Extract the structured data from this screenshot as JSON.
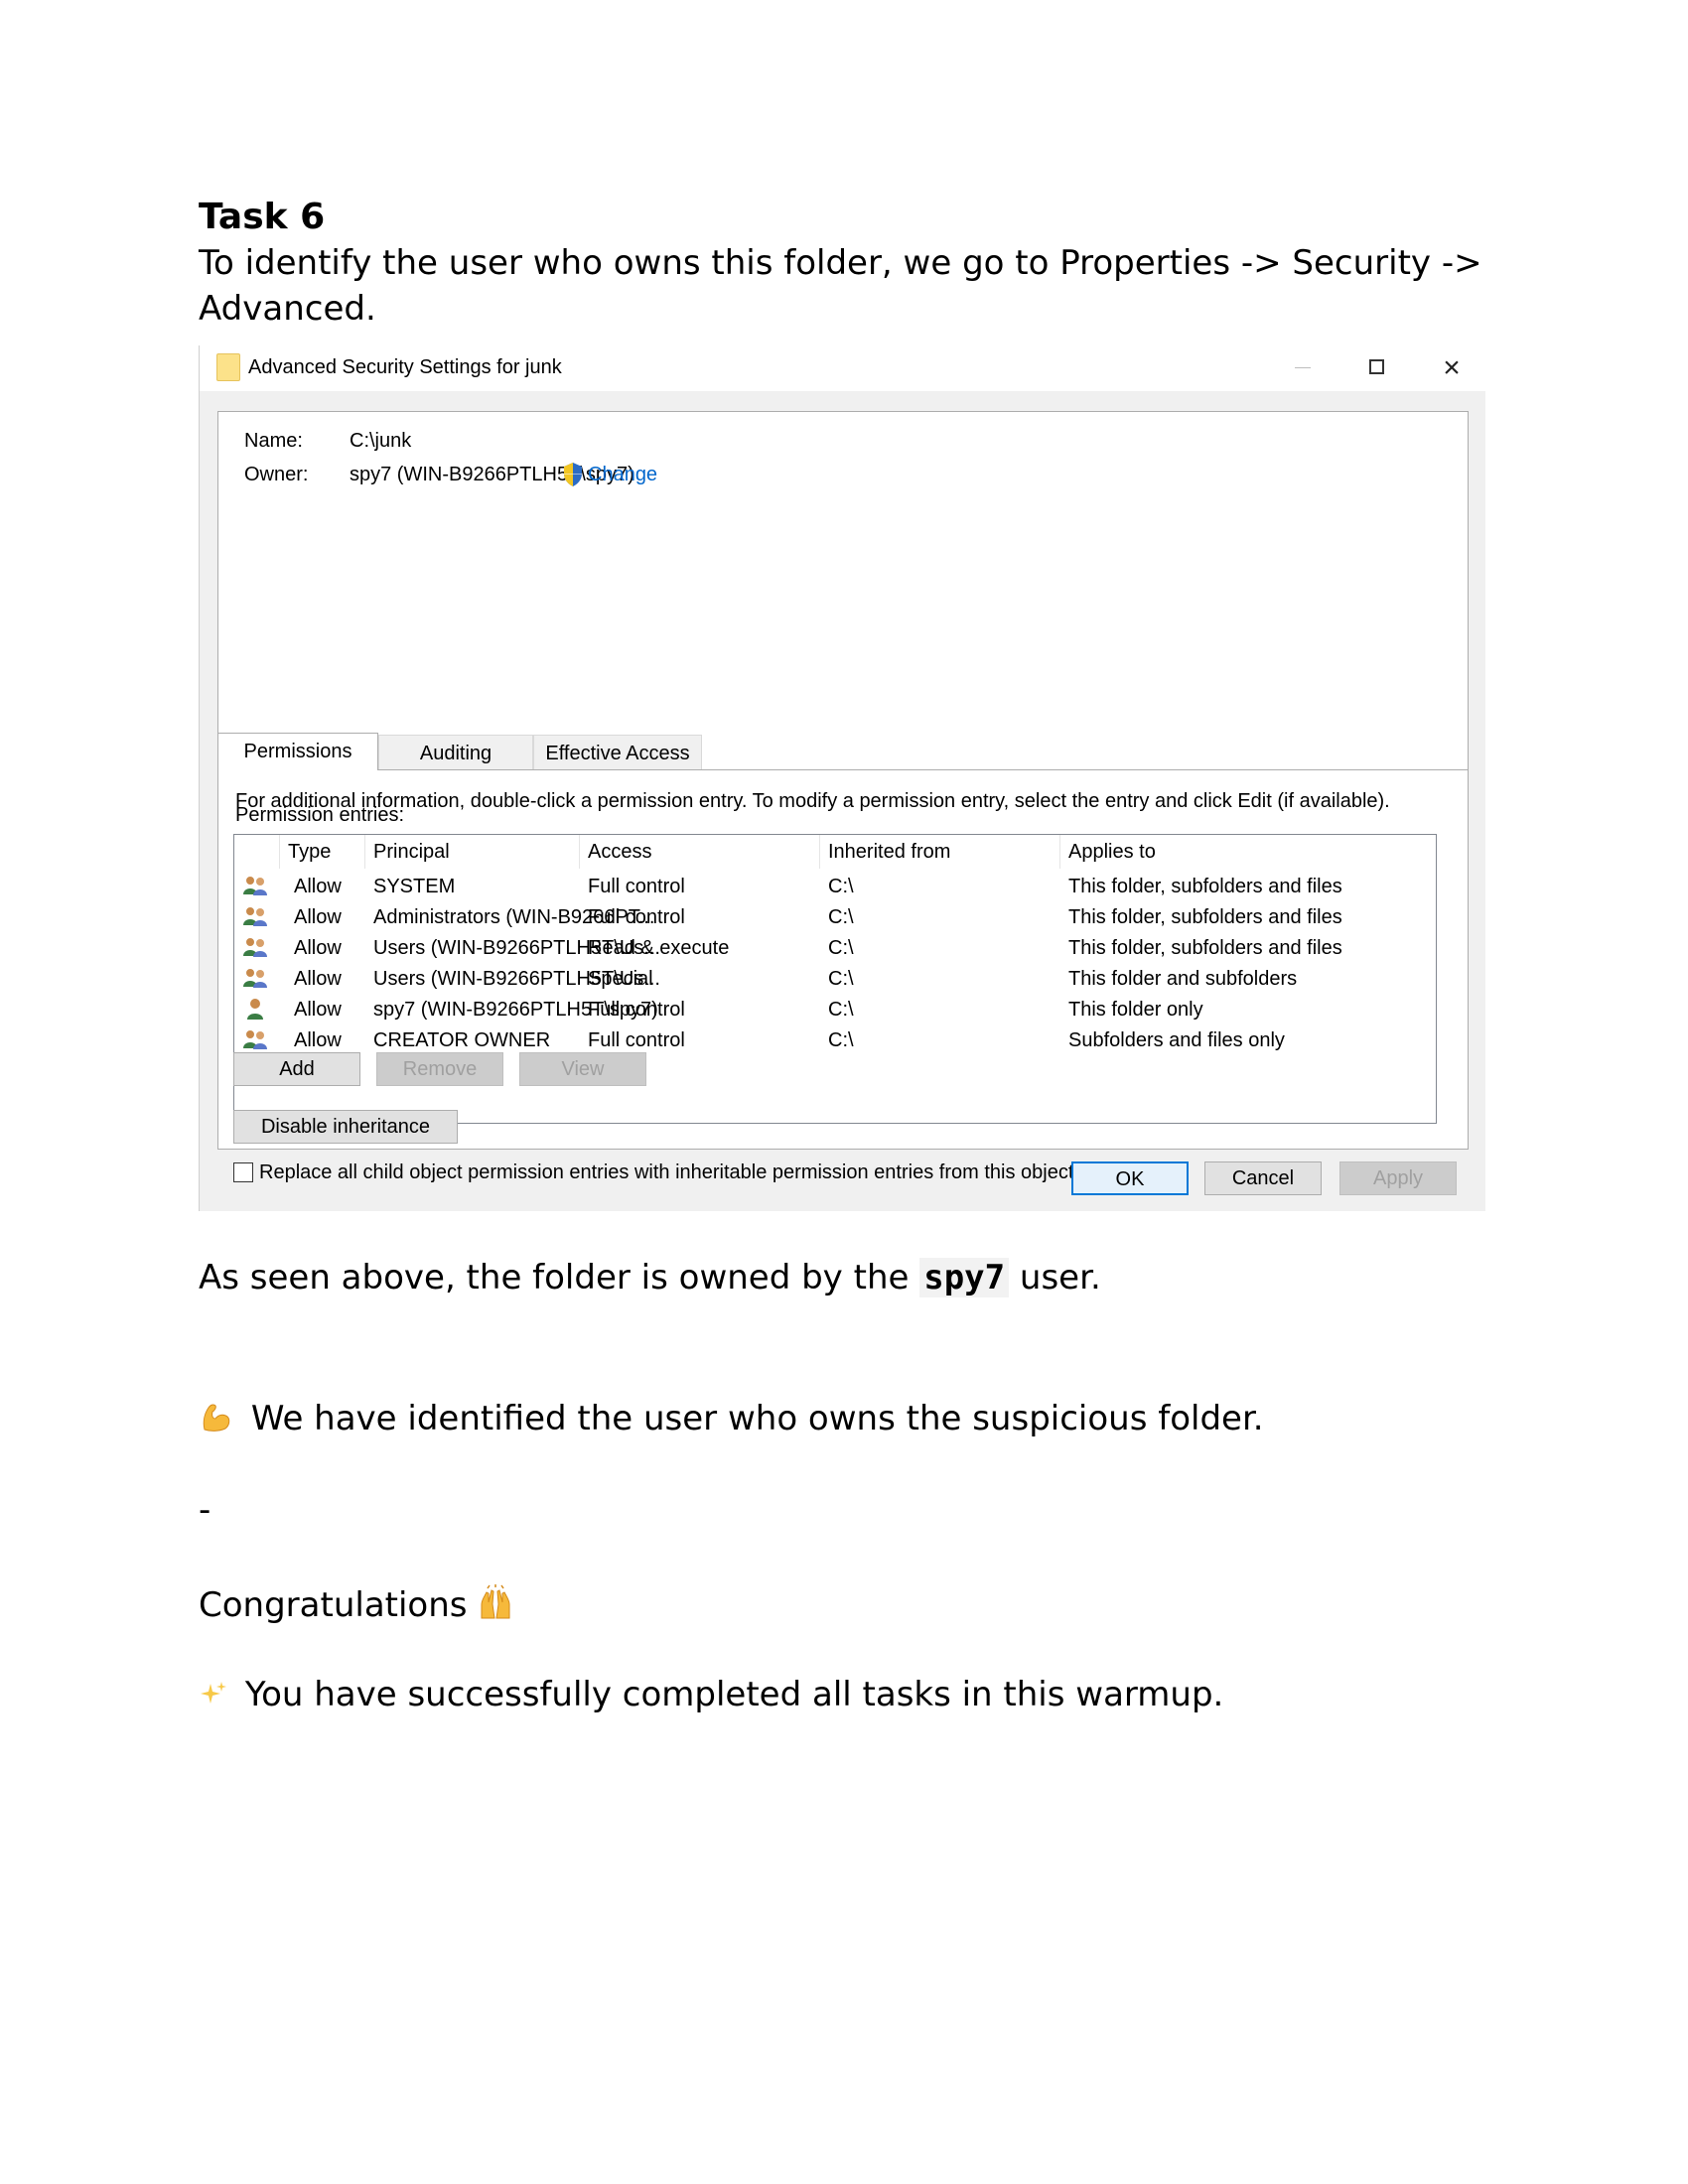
{
  "heading": "Task 6",
  "intro": "To identify the user who owns this folder, we go to Properties -> Security -> Advanced.",
  "dialog": {
    "title": "Advanced Security Settings for junk",
    "name_label": "Name:",
    "name_value": "C:\\junk",
    "owner_label": "Owner:",
    "owner_value": "spy7 (WIN-B9266PTLH5T\\spy7)",
    "change_link": "Change",
    "tabs": [
      "Permissions",
      "Auditing",
      "Effective Access"
    ],
    "info_text": "For additional information, double-click a permission entry. To modify a permission entry, select the entry and click Edit (if available).",
    "entries_label": "Permission entries:",
    "columns": [
      "Type",
      "Principal",
      "Access",
      "Inherited from",
      "Applies to"
    ],
    "rows": [
      {
        "icon": "users-group-icon",
        "type": "Allow",
        "principal": "SYSTEM",
        "access": "Full control",
        "inherited": "C:\\",
        "applies": "This folder, subfolders and files"
      },
      {
        "icon": "users-group-icon",
        "type": "Allow",
        "principal": "Administrators (WIN-B9266PT...",
        "access": "Full control",
        "inherited": "C:\\",
        "applies": "This folder, subfolders and files"
      },
      {
        "icon": "users-group-icon",
        "type": "Allow",
        "principal": "Users (WIN-B9266PTLH5T\\Us...",
        "access": "Read & execute",
        "inherited": "C:\\",
        "applies": "This folder, subfolders and files"
      },
      {
        "icon": "users-group-icon",
        "type": "Allow",
        "principal": "Users (WIN-B9266PTLH5T\\Us...",
        "access": "Special",
        "inherited": "C:\\",
        "applies": "This folder and subfolders"
      },
      {
        "icon": "single-user-icon",
        "type": "Allow",
        "principal": "spy7 (WIN-B9266PTLH5T\\spy7)",
        "access": "Full control",
        "inherited": "C:\\",
        "applies": "This folder only"
      },
      {
        "icon": "users-group-icon",
        "type": "Allow",
        "principal": "CREATOR OWNER",
        "access": "Full control",
        "inherited": "C:\\",
        "applies": "Subfolders and files only"
      }
    ],
    "buttons": {
      "add": "Add",
      "remove": "Remove",
      "view": "View",
      "disable_inheritance": "Disable inheritance",
      "ok": "OK",
      "cancel": "Cancel",
      "apply": "Apply"
    },
    "replace_checkbox_label": "Replace all child object permission entries with inheritable permission entries from this object"
  },
  "after": {
    "seen_prefix": "As seen above, the folder is owned by the ",
    "seen_user": "spy7",
    "seen_suffix": " user.",
    "identified": "We have identified the user who owns the suspicious folder.",
    "dash": "-",
    "congrats": "Congratulations",
    "completed": "You have successfully completed all tasks in this warmup."
  }
}
